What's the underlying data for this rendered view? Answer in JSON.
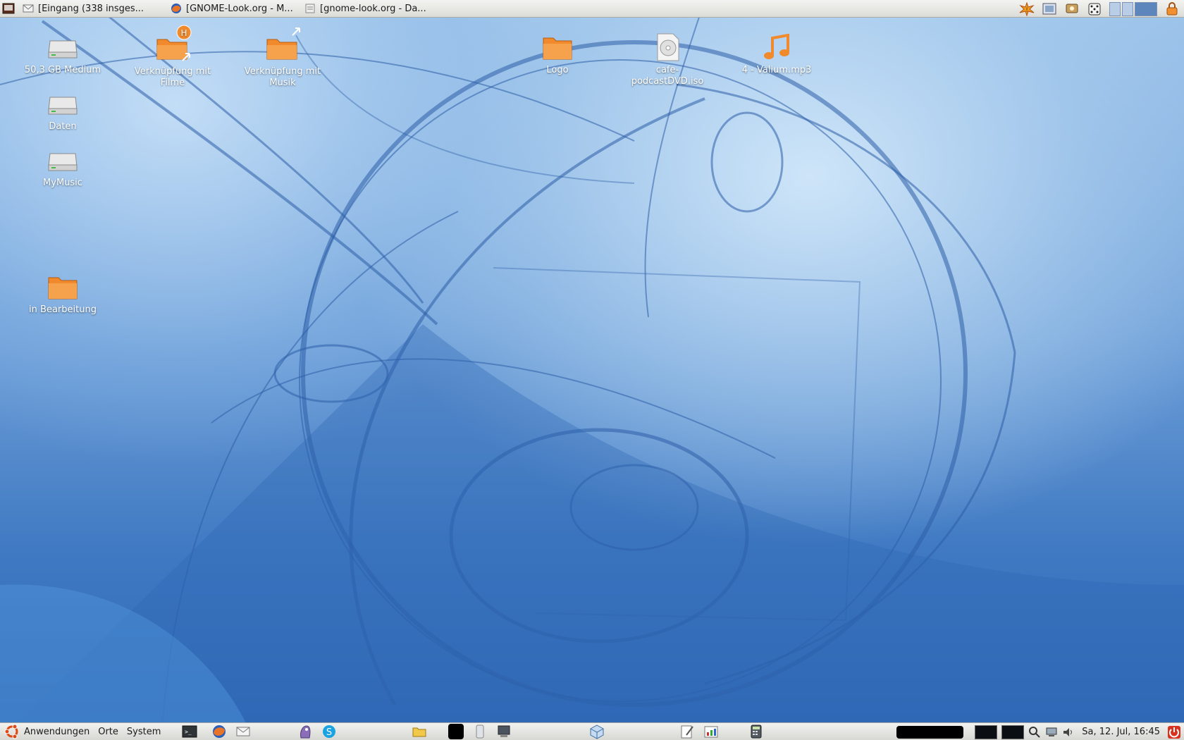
{
  "top_panel": {
    "tasks": [
      {
        "label": "[Eingang (338 insges...",
        "icon": "mail-icon"
      },
      {
        "label": "[GNOME-Look.org - M...",
        "icon": "firefox-icon"
      },
      {
        "label": "[gnome-look.org - Da...",
        "icon": "document-icon"
      }
    ],
    "tray_icons": [
      "warning-burst-icon",
      "screenshot-icon",
      "display-settings-icon",
      "dice-icon"
    ],
    "workspaces": 3,
    "active_workspace": 3
  },
  "desktop_icons": [
    {
      "label": "50,3 GB Medium",
      "icon": "drive-icon"
    },
    {
      "label": "Verknüpfung mit Filme",
      "icon": "folder-link-icon"
    },
    {
      "label": "Verknüpfung mit Musik",
      "icon": "folder-link-icon"
    },
    {
      "label": "Logo",
      "icon": "folder-icon"
    },
    {
      "label": "cafe-podcastDVD.iso",
      "icon": "disc-image-icon"
    },
    {
      "label": "4 - Valium.mp3",
      "icon": "music-note-icon"
    },
    {
      "label": "Daten",
      "icon": "drive-icon"
    },
    {
      "label": "MyMusic",
      "icon": "drive-icon"
    },
    {
      "label": "in Bearbeitung",
      "icon": "folder-icon"
    }
  ],
  "bottom_panel": {
    "menus": [
      "Anwendungen",
      "Orte",
      "System"
    ],
    "launchers": [
      "terminal-icon",
      "firefox-icon",
      "mail-icon",
      "pidgin-icon",
      "skype-icon",
      "folder-icon",
      "removable-icon",
      "network-icon",
      "cube-icon",
      "editor-icon",
      "chart-icon",
      "calculator-icon"
    ],
    "clock": "Sa, 12. Jul, 16:45",
    "tray_icons": [
      "search-icon",
      "computer-icon",
      "volume-icon",
      "shutdown-icon"
    ]
  },
  "colors": {
    "panel": "#e6e6e3",
    "wallpaper_blue": "#3f78bf",
    "folder_orange": "#f08a2c",
    "shutdown_red": "#d9321f"
  }
}
